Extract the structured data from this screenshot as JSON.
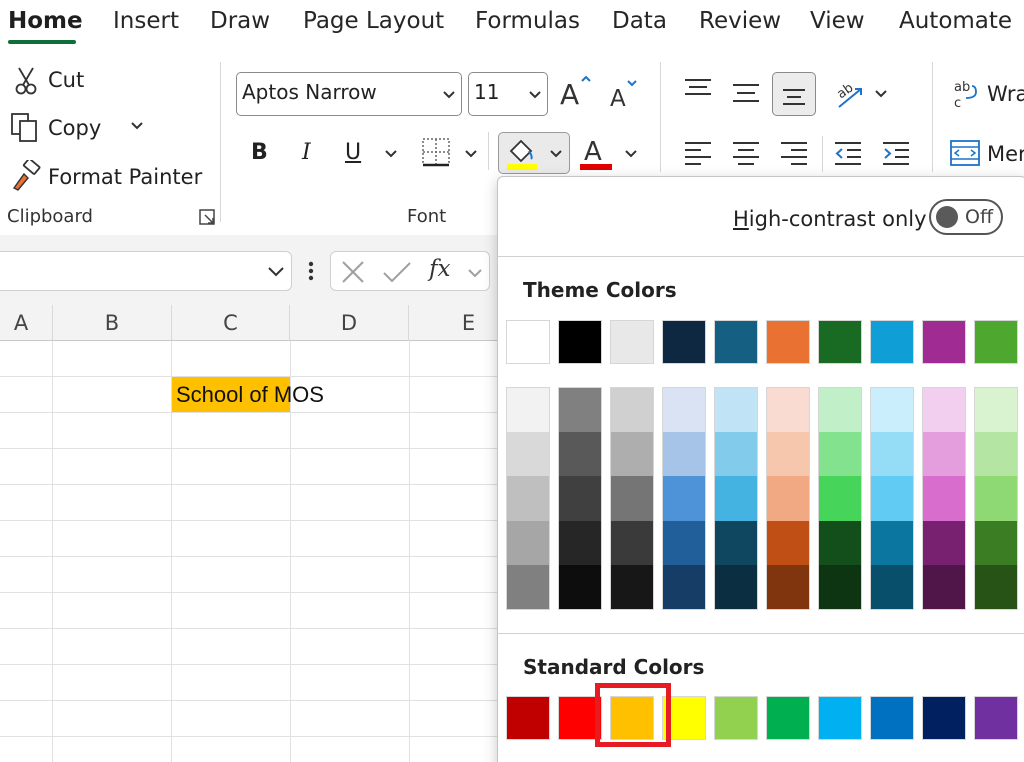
{
  "tabs": {
    "items": [
      "Home",
      "Insert",
      "Draw",
      "Page Layout",
      "Formulas",
      "Data",
      "Review",
      "View",
      "Automate"
    ],
    "active": "Home"
  },
  "ribbon": {
    "clipboard": {
      "cut": "Cut",
      "copy": "Copy",
      "format_painter": "Format Painter",
      "label": "Clipboard"
    },
    "font": {
      "family": "Aptos Narrow",
      "size": "11",
      "bold": "B",
      "italic": "I",
      "underline": "U",
      "label": "Font",
      "fill_color": "#ffff00",
      "font_color": "#e00000"
    },
    "alignment": {
      "wrap_text": "Wra",
      "merge": "Mer"
    }
  },
  "formula_bar": {
    "fx": "fx"
  },
  "sheet": {
    "columns": [
      "A",
      "B",
      "C",
      "D",
      "E"
    ],
    "cell_c2": {
      "value": "School of MOS",
      "fill": "#ffc000"
    }
  },
  "color_picker": {
    "high_contrast_label": "High-contrast only",
    "toggle_state": "Off",
    "theme_title": "Theme Colors",
    "standard_title": "Standard Colors",
    "theme_base": [
      "#ffffff",
      "#000000",
      "#e8e8e8",
      "#0e2841",
      "#156082",
      "#e97132",
      "#196b24",
      "#0f9ed5",
      "#a02b93",
      "#4ea72e"
    ],
    "theme_shades": [
      [
        "#f2f2f2",
        "#d9d9d9",
        "#bfbfbf",
        "#a6a6a6",
        "#808080"
      ],
      [
        "#808080",
        "#595959",
        "#404040",
        "#262626",
        "#0d0d0d"
      ],
      [
        "#d0d0d0",
        "#aeaeae",
        "#757575",
        "#3a3a3a",
        "#171717"
      ],
      [
        "#dae3f3",
        "#a6c3e8",
        "#4e92d8",
        "#215f9a",
        "#163d66"
      ],
      [
        "#c0e4f5",
        "#83cbeb",
        "#44b3e1",
        "#0f4761",
        "#0b2f40"
      ],
      [
        "#fadbd2",
        "#f6c6ad",
        "#f1a983",
        "#c04f15",
        "#80350e"
      ],
      [
        "#c1f0c8",
        "#83e28e",
        "#47d45a",
        "#124f1a",
        "#0d3512"
      ],
      [
        "#caeefb",
        "#95dcf7",
        "#61cbf3",
        "#0b76a0",
        "#074f6a"
      ],
      [
        "#f2ceef",
        "#e59edd",
        "#d86dcd",
        "#782170",
        "#501549"
      ],
      [
        "#d9f2d0",
        "#b4e5a2",
        "#8ed973",
        "#3a7d22",
        "#275317"
      ]
    ],
    "standard": [
      "#c00000",
      "#ff0000",
      "#ffc000",
      "#ffff00",
      "#92d050",
      "#00b050",
      "#00b0f0",
      "#0070c0",
      "#002060",
      "#7030a0"
    ],
    "selected_standard": "#ffc000"
  }
}
